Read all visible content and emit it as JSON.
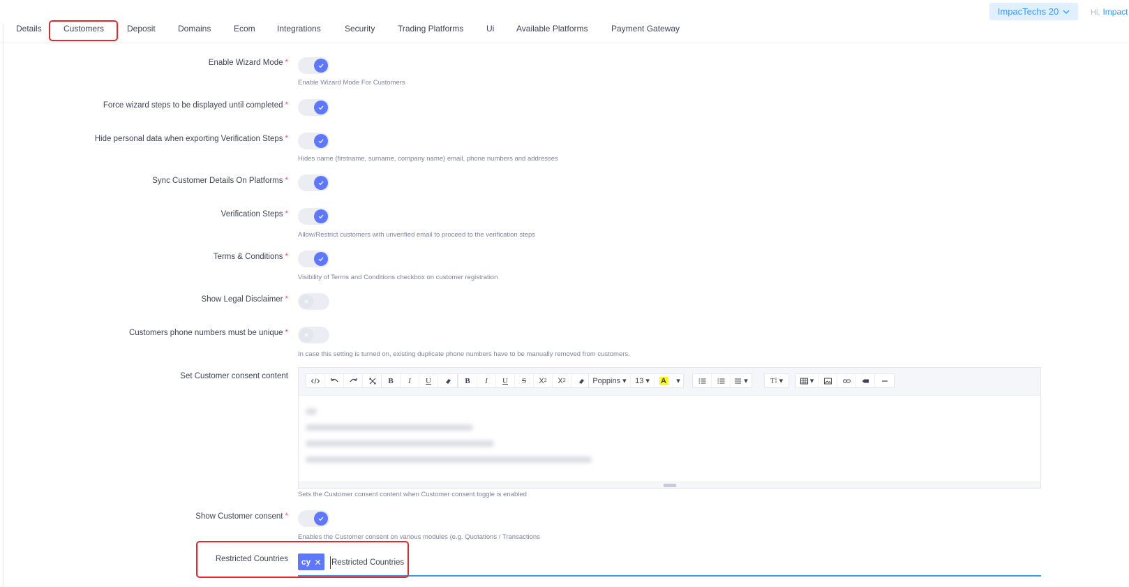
{
  "header": {
    "company": "ImpacTechs 20",
    "greeting_hi": "Hi,",
    "greeting_name": "Impact"
  },
  "tabs": [
    "Details",
    "Customers",
    "Deposit",
    "Domains",
    "Ecom",
    "Integrations",
    "Security",
    "Trading Platforms",
    "Ui",
    "Available Platforms",
    "Payment Gateway"
  ],
  "active_tab": "Customers",
  "settings": {
    "wizard": {
      "label": "Enable Wizard Mode",
      "on": true,
      "help": "Enable Wizard Mode For Customers"
    },
    "force_wizard": {
      "label": "Force wizard steps to be displayed until completed",
      "on": true
    },
    "hide_personal": {
      "label": "Hide personal data when exporting Verification Steps",
      "on": true,
      "help": "Hides name (firstname, surname, company name) email, phone numbers and addresses"
    },
    "sync": {
      "label": "Sync Customer Details On Platforms",
      "on": true
    },
    "verification": {
      "label": "Verification Steps",
      "on": true,
      "help": "Allow/Restrict customers with unverified email to proceed to the verification steps"
    },
    "terms": {
      "label": "Terms & Conditions",
      "on": true,
      "help": "Visibility of Terms and Conditions checkbox on customer registration"
    },
    "legal": {
      "label": "Show Legal Disclaimer",
      "on": false
    },
    "phone_unique": {
      "label": "Customers phone numbers must be unique",
      "on": false,
      "help": "In case this setting is turned on, existing duplicate phone numbers have to be manually removed from customers."
    },
    "consent_content": {
      "label": "Set Customer consent content",
      "help": "Sets the Customer consent content when Customer consent toggle is enabled"
    },
    "show_consent": {
      "label": "Show Customer consent",
      "on": true,
      "help": "Enables the Customer consent on various modules (e.g. Quotations / Transactions"
    },
    "restricted": {
      "label": "Restricted Countries",
      "chip": "cy",
      "placeholder": "Restricted Countries"
    }
  },
  "editor_toolbar": {
    "font": "Poppins",
    "size": "13",
    "highlight": "A",
    "para": "T",
    "bold": "B",
    "italic": "I",
    "underline": "U",
    "strike": "S",
    "sup": "X",
    "sub": "X"
  },
  "colors": {
    "accent": "#5d78ff",
    "required": "#f64e60",
    "highlight_box": "#e3262b"
  }
}
